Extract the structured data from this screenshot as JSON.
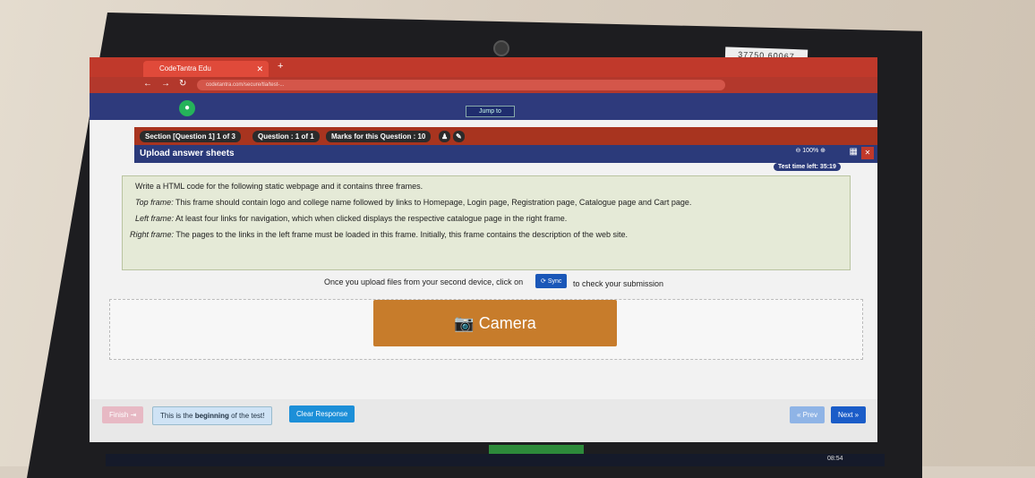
{
  "browser": {
    "tab_title": "CodeTantra Edu",
    "url": "codetantra.com/secure/tla/test-...",
    "jump_label": "Jump to"
  },
  "header": {
    "section": "Section [Question 1] 1 of 3",
    "question": "Question : 1 of 1",
    "marks": "Marks for this Question : 10",
    "page_title": "Upload answer sheets",
    "zoom": "100%",
    "timer": "Test time left: 35:19"
  },
  "question": {
    "intro": "Write a HTML code for the following static webpage and it contains three frames.",
    "lines": [
      {
        "label": "Top frame:",
        "text": " This frame should contain logo and college name followed by links to Homepage, Login page, Registration page, Catalogue page and Cart page."
      },
      {
        "label": "Left frame:",
        "text": " At least four links for navigation, which when clicked displays the respective catalogue page in the right frame."
      },
      {
        "label": "Right frame:",
        "text": " The pages to the links in the left frame must be loaded in this frame. Initially, this frame contains the description of the web site."
      }
    ]
  },
  "upload": {
    "text_before": "Once you upload files from your second device, click on",
    "sync_label": "Sync",
    "text_after": "to check your submission",
    "camera_label": "Camera"
  },
  "footer": {
    "finish": "Finish",
    "beginning_prefix": "This is the ",
    "beginning_bold": "beginning",
    "beginning_suffix": " of the test!",
    "clear": "Clear Response",
    "prev": "« Prev",
    "next": "Next »"
  },
  "sticker": "37750 60067",
  "clock": "08:54"
}
